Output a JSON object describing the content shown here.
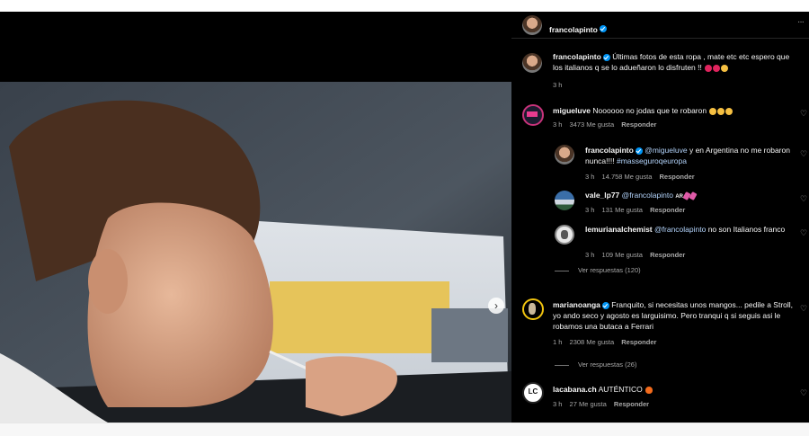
{
  "post": {
    "author": "francolapinto",
    "more_label": "···",
    "next_label": "›",
    "caption": {
      "text": "Últimas fotos de esta ropa , mate etc etc espero que los italianos q se lo adueñaron lo disfruten !!",
      "time": "3 h"
    }
  },
  "comments": [
    {
      "user": "migueluve",
      "text": "Noooooo no jodas que te robaron",
      "time": "3 h",
      "likes": "3473 Me gusta",
      "reply": "Responder",
      "replies": [
        {
          "user": "francolapinto",
          "mention": "@migueluve",
          "text": "y en Argentina no me robaron nunca!!!!",
          "hashtag": "#masseguroqeuropa",
          "time": "3 h",
          "likes": "14.758 Me gusta",
          "reply": "Responder"
        },
        {
          "user": "vale_lp77",
          "mention": "@francolapinto",
          "text": "AR",
          "time": "3 h",
          "likes": "131 Me gusta",
          "reply": "Responder"
        },
        {
          "user": "lemurianalchemist",
          "mention": "@francolapinto",
          "text": "no son Italianos franco",
          "time": "3 h",
          "likes": "109 Me gusta",
          "reply": "Responder"
        }
      ],
      "view_more": "Ver respuestas (120)"
    },
    {
      "user": "marianoanga",
      "text": "Franquito, si necesitas unos mangos... pedile a Stroll, yo ando seco y agosto es larguisimo. Pero tranqui q si seguis asi le robamos una butaca a Ferrari",
      "time": "1 h",
      "likes": "2308 Me gusta",
      "reply": "Responder",
      "view_more": "Ver respuestas (26)"
    },
    {
      "user": "lacabana.ch",
      "avatar_text": "LC",
      "text": "AUTÉNTICO",
      "time": "3 h",
      "likes": "27 Me gusta",
      "reply": "Responder"
    }
  ],
  "icons": {
    "heart": "heart-icon",
    "verified": "verified-badge-icon",
    "next": "chevron-right-icon",
    "more": "more-options-icon"
  },
  "colors": {
    "background": "#000000",
    "verified": "#0095f6",
    "mention": "#b3d4fc",
    "muted": "#a8a8a8"
  }
}
